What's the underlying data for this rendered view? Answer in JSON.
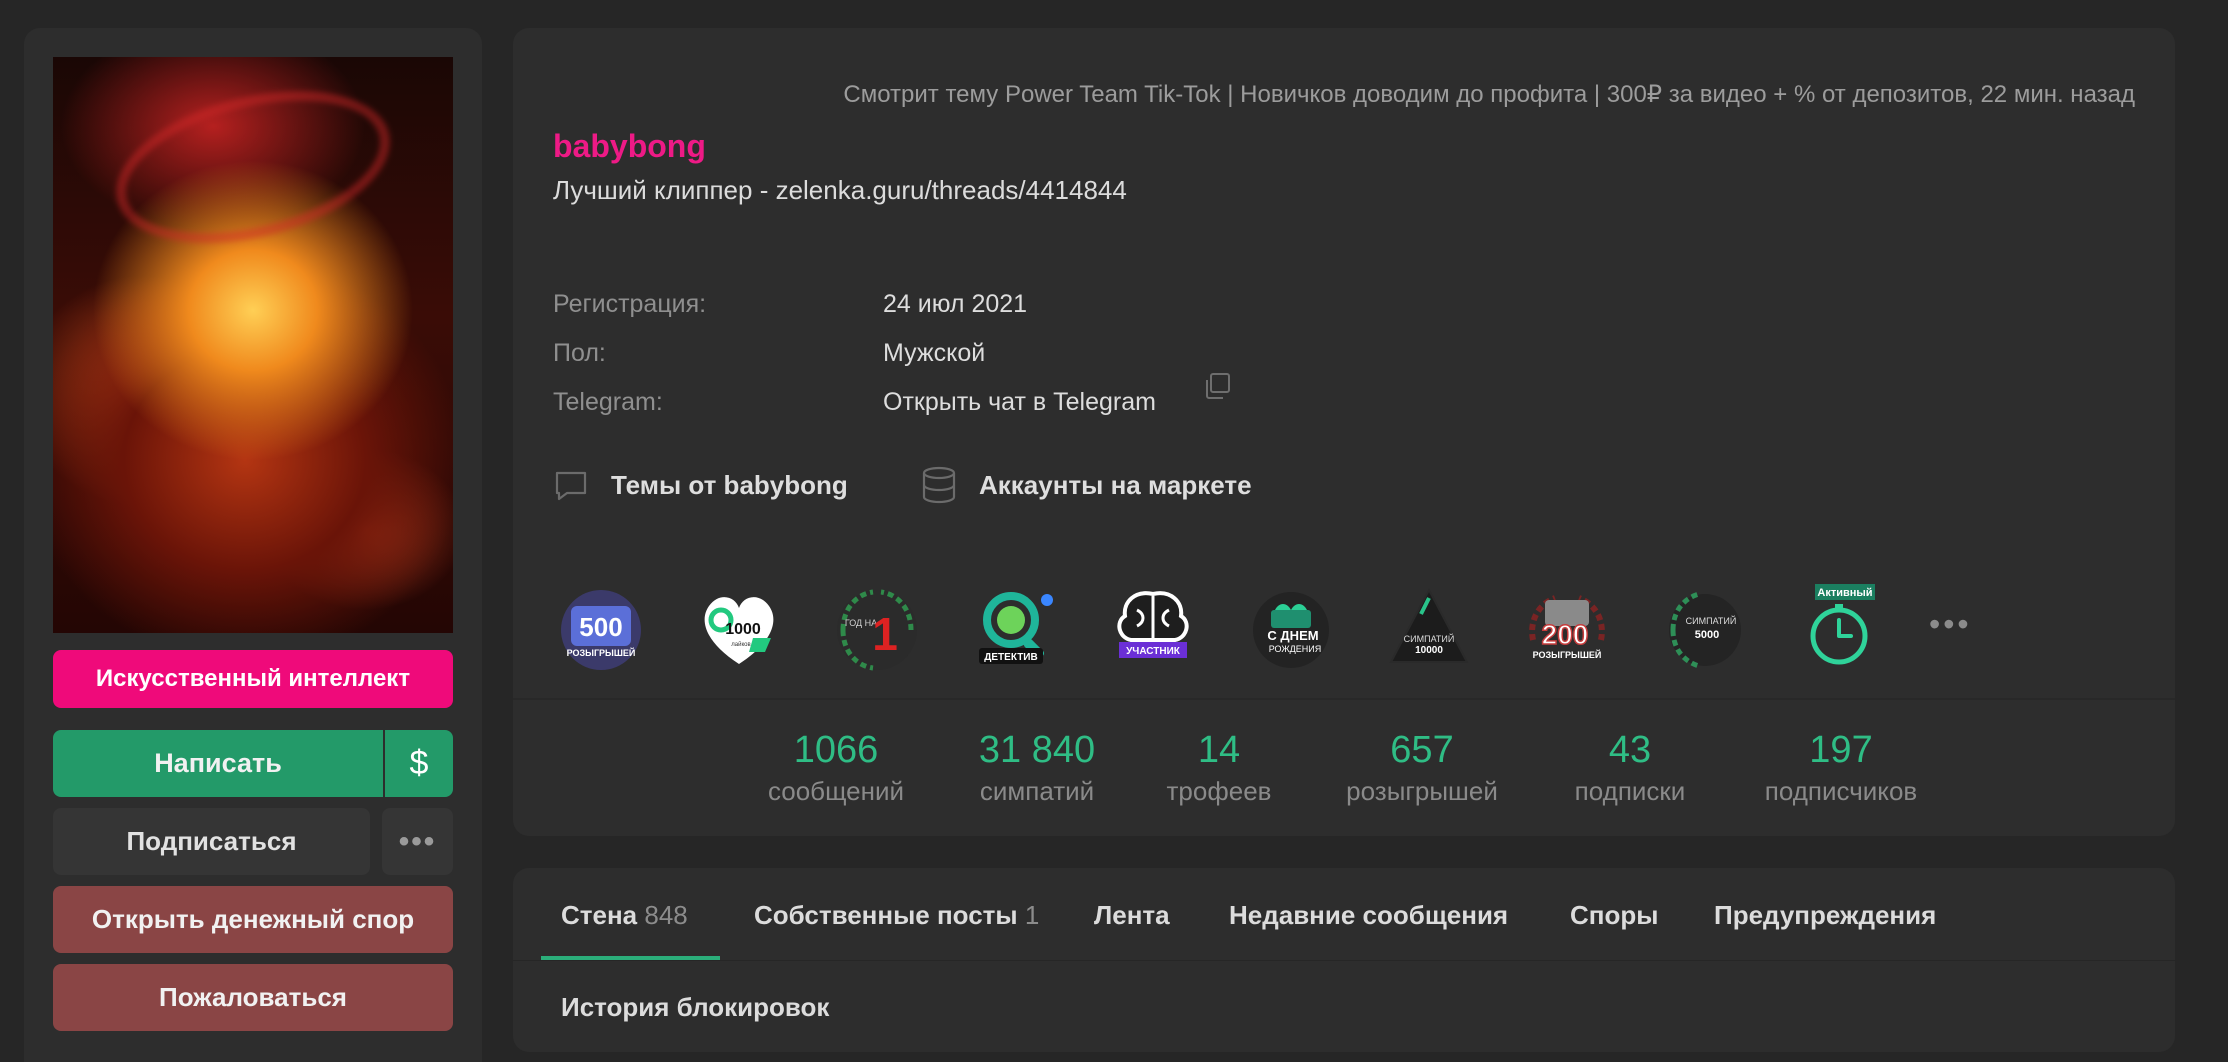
{
  "sidebar": {
    "ai_button": "Искусственный интеллект",
    "write_button": "Написать",
    "dollar_button": "$",
    "follow_button": "Подписаться",
    "more_button": "•••",
    "dispute_button": "Открыть денежный спор",
    "report_button": "Пожаловаться"
  },
  "profile": {
    "status": "Смотрит тему Power Team Tik-Tok | Новичков доводим до профита | 300₽ за видео + % от депозитов, 22 мин. назад",
    "username": "babybong",
    "title": "Лучший клиппер - zelenka.guru/threads/4414844",
    "username_color": "#ee1a86",
    "info": [
      {
        "label": "Регистрация:",
        "value": "24 июл 2021"
      },
      {
        "label": "Пол:",
        "value": "Мужской"
      },
      {
        "label": "Telegram:",
        "value": "Открыть чат в Telegram"
      }
    ],
    "links": {
      "threads": "Темы от babybong",
      "market": "Аккаунты на маркете"
    },
    "trophies": [
      {
        "icon": "500-giveaways-badge",
        "text_top": "500",
        "text_bottom": "РОЗЫГРЫШЕЙ"
      },
      {
        "icon": "1000-likes-heart-badge",
        "text_top": "1000",
        "text_bottom": "лайков"
      },
      {
        "icon": "one-year-laurel-badge",
        "text_top": "ГОД НА",
        "text_bottom": "1"
      },
      {
        "icon": "detective-badge",
        "text_top": "",
        "text_bottom": "ДЕТЕКТИВ"
      },
      {
        "icon": "member-brain-badge",
        "text_top": "",
        "text_bottom": "УЧАСТНИК"
      },
      {
        "icon": "birthday-cake-badge",
        "text_top": "С ДНЕМ",
        "text_bottom": "РОЖДЕНИЯ"
      },
      {
        "icon": "10000-likes-triangle-badge",
        "text_top": "СИМПАТИЙ",
        "text_bottom": "10000"
      },
      {
        "icon": "200-giveaways-badge",
        "text_top": "200",
        "text_bottom": "РОЗЫГРЫШЕЙ"
      },
      {
        "icon": "5000-likes-laurel-badge",
        "text_top": "СИМПАТИЙ",
        "text_bottom": "5000"
      },
      {
        "icon": "active-stopwatch-badge",
        "text_top": "Активный",
        "text_bottom": ""
      }
    ],
    "more_trophies": "•••",
    "stats": [
      {
        "value": "1066",
        "label": "сообщений"
      },
      {
        "value": "31 840",
        "label": "симпатий"
      },
      {
        "value": "14",
        "label": "трофеев"
      },
      {
        "value": "657",
        "label": "розыгрышей"
      },
      {
        "value": "43",
        "label": "подписки"
      },
      {
        "value": "197",
        "label": "подписчиков"
      }
    ],
    "stat_color": "#2fbd85"
  },
  "tabs": [
    {
      "label": "Стена",
      "count": "848"
    },
    {
      "label": "Собственные посты",
      "count": "1"
    },
    {
      "label": "Лента",
      "count": ""
    },
    {
      "label": "Недавние сообщения",
      "count": ""
    },
    {
      "label": "Споры",
      "count": ""
    },
    {
      "label": "Предупреждения",
      "count": ""
    },
    {
      "label": "История блокировок",
      "count": ""
    }
  ],
  "colors": {
    "accent_green": "#239a69",
    "accent_pink": "#ef0a7a",
    "danger": "#8a4545",
    "background": "#262626",
    "card": "#2d2d2d"
  }
}
